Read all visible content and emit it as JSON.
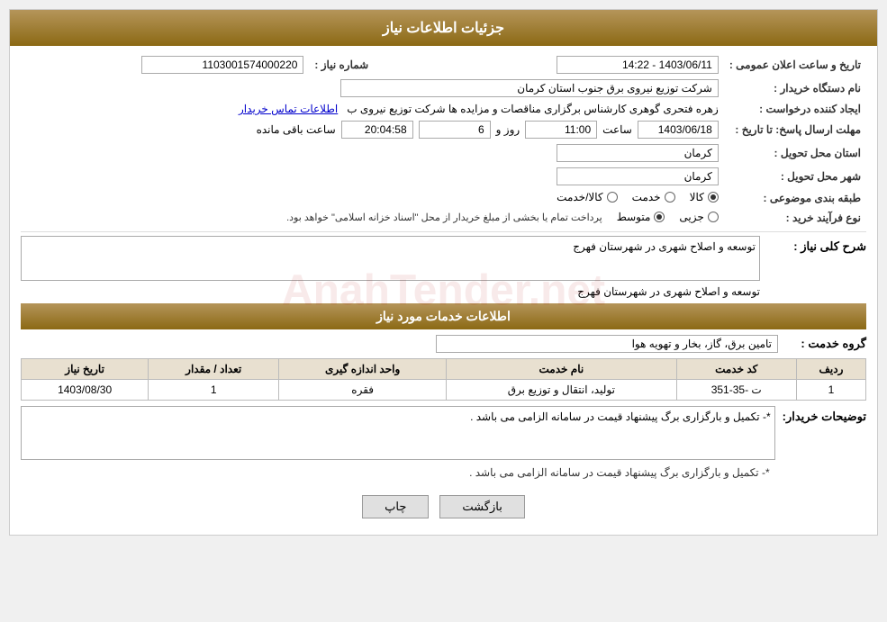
{
  "header": {
    "title": "جزئیات اطلاعات نیاز"
  },
  "fields": {
    "shomara_niaz_label": "شماره نیاز :",
    "shomara_niaz_value": "1103001574000220",
    "nam_dastgah_label": "نام دستگاه خریدار :",
    "nam_dastgah_value": "شرکت توزیع نیروی برق جنوب استان کرمان",
    "ijad_label": "ایجاد کننده درخواست :",
    "ijad_value": "زهره فتحری گوهری کارشناس برگزاری مناقصات و مزایده ها شرکت توزیع نیروی ب",
    "ijad_link": "اطلاعات تماس خریدار",
    "mohlat_label": "مهلت ارسال پاسخ: تا تاریخ :",
    "tarikh_elan_label": "تاریخ و ساعت اعلان عمومی :",
    "tarikh_elan_value": "1403/06/11 - 14:22",
    "tarikh_pasokh_value": "1403/06/18",
    "saat_pasokh_value": "11:00",
    "roz_value": "6",
    "baqi_value": "20:04:58",
    "ostan_label": "استان محل تحویل :",
    "ostan_value": "کرمان",
    "shahr_label": "شهر محل تحویل :",
    "shahr_value": "کرمان",
    "tabaqe_label": "طبقه بندی موضوعی :",
    "tabaqe_kala": "کالا",
    "tabaqe_khedmat": "خدمت",
    "tabaqe_kala_khedmat": "کالا/خدمت",
    "noE_label": "نوع فرآیند خرید :",
    "noE_jezii": "جزیی",
    "noE_motevaset": "متوسط",
    "noE_pardakht": "پرداخت تمام یا بخشی از مبلغ خریدار از محل \"اسناد خزانه اسلامی\" خواهد بود.",
    "sharh_label": "شرح کلی نیاز :",
    "sharh_value": "توسعه و اصلاح شهری در شهرستان فهرج",
    "services_header": "اطلاعات خدمات مورد نیاز",
    "grooh_label": "گروه خدمت :",
    "grooh_value": "تامین برق، گاز، بخار و تهویه هوا",
    "table": {
      "headers": [
        "ردیف",
        "کد خدمت",
        "نام خدمت",
        "واحد اندازه گیری",
        "تعداد / مقدار",
        "تاریخ نیاز"
      ],
      "rows": [
        {
          "radif": "1",
          "kod": "ت -35-351",
          "nam": "تولید، انتقال و توزیع برق",
          "vahed": "فقره",
          "tedad": "1",
          "tarikh": "1403/08/30"
        }
      ]
    },
    "توضیحات_label": "توضیحات خریدار:",
    "توضیحات_value": "*- تکمیل و بارگزاری برگ پیشنهاد قیمت در سامانه الزامی می باشد .",
    "btn_print": "چاپ",
    "btn_back": "بازگشت"
  }
}
